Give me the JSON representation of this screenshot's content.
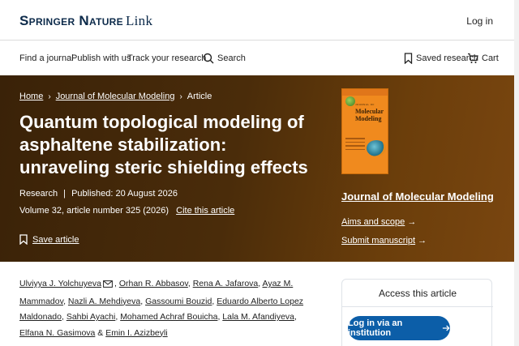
{
  "header": {
    "logo_brand": "Springer Nature",
    "logo_link": "Link",
    "login": "Log in"
  },
  "nav": {
    "find_journal": "Find a journal",
    "publish": "Publish with us",
    "track": "Track your research",
    "search": "Search",
    "saved": "Saved research",
    "cart": "Cart"
  },
  "breadcrumb": {
    "home": "Home",
    "journal": "Journal of Molecular Modeling",
    "current": "Article"
  },
  "article": {
    "title": "Quantum topological modeling of asphaltene stabilization: unraveling steric shielding effects",
    "type": "Research",
    "published": "Published: 20 August 2026",
    "volume": "Volume 32, article number 325 (2026)",
    "cite": "Cite this article",
    "save": "Save article"
  },
  "journal": {
    "cover_line1": "Molecular",
    "cover_line2": "Modeling",
    "cover_top": "JOURNAL OF",
    "name": "Journal of Molecular Modeling",
    "aims": "Aims and scope",
    "submit": "Submit manuscript"
  },
  "authors": [
    "Ulviyya J. Yolchuyeva",
    "Orhan R. Abbasov",
    "Rena A. Jafarova",
    "Ayaz M. Mammadov",
    "Nazli A. Mehdiyeva",
    "Gassoumi Bouzid",
    "Eduardo Alberto Lopez Maldonado",
    "Sahbi Ayachi",
    "Mohamed Achraf Bouicha",
    "Lala M. Afandiyeva",
    "Elfana N. Gasimova",
    "Emin I. Azizbeyli"
  ],
  "access": {
    "title": "Access this article",
    "institution_button": "Log in via an institution"
  },
  "colors": {
    "hero_bg": "#4a2c0a",
    "brand_navy": "#0c2a4a",
    "button_blue": "#0c5ea8",
    "cover_orange": "#f08a1e"
  }
}
